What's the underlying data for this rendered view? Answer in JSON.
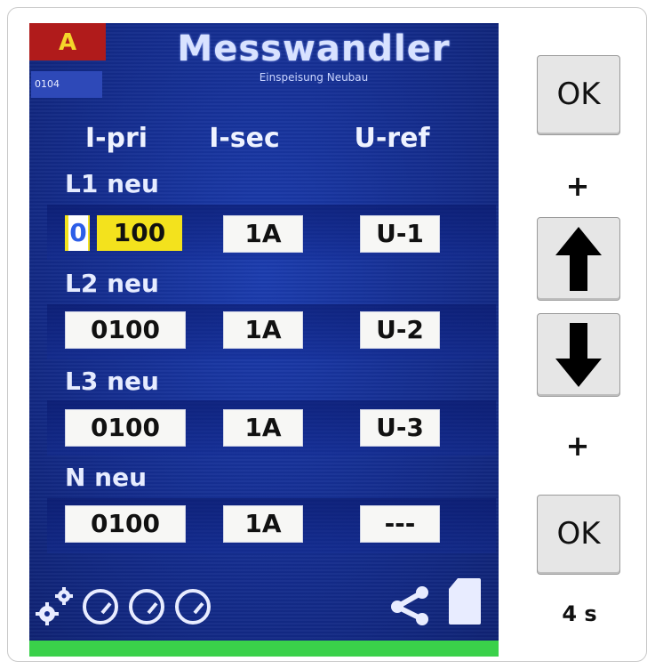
{
  "device": {
    "title": "Messwandler",
    "subtitle": "Einspeisung Neubau",
    "alarm_badge": "A",
    "id_badge": "0104"
  },
  "columns": [
    "I-pri",
    "I-sec",
    "U-ref"
  ],
  "rows": [
    {
      "label": "L1 neu",
      "i_pri": "0100",
      "i_pri_cursor_digit": "0",
      "i_pri_rest": "100",
      "i_sec": "1A",
      "u_ref": "U-1"
    },
    {
      "label": "L2 neu",
      "i_pri": "0100",
      "i_sec": "1A",
      "u_ref": "U-2"
    },
    {
      "label": "L3 neu",
      "i_pri": "0100",
      "i_sec": "1A",
      "u_ref": "U-3"
    },
    {
      "label": "N neu",
      "i_pri": "0100",
      "i_sec": "1A",
      "u_ref": "---"
    }
  ],
  "status_icons": [
    "gears-icon",
    "gauge-icon",
    "gauge-icon",
    "gauge-icon",
    "share-icon",
    "sd-card-icon"
  ],
  "colors": {
    "screen_blue": "#142c8d",
    "cursor_yellow": "#f3e21d",
    "alarm_red": "#b01b1b",
    "ok_green": "#3ad14a"
  },
  "side_panel": {
    "ok_top": "OK",
    "plus_1": "+",
    "plus_2": "+",
    "ok_bottom": "OK",
    "hold_time": "4 s"
  }
}
